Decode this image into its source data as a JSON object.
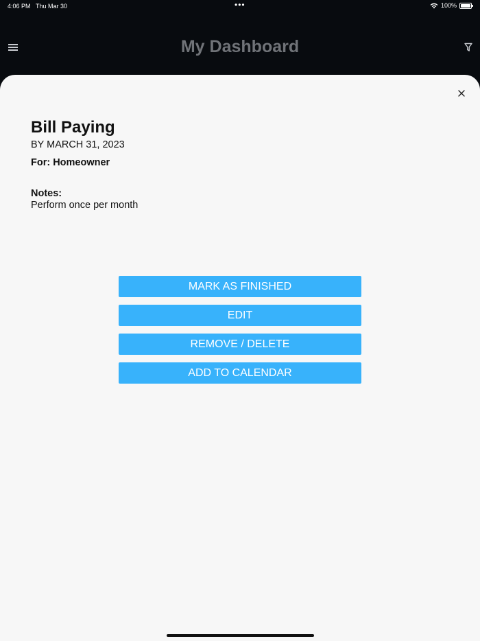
{
  "status_bar": {
    "time": "4:06 PM",
    "date": "Thu Mar 30",
    "battery": "100%",
    "battery_level": 1.0
  },
  "header": {
    "title": "My Dashboard",
    "menu_icon": "hamburger-menu-icon",
    "filter_icon": "filter-icon"
  },
  "task": {
    "title": "Bill Paying",
    "due": "BY MARCH 31, 2023",
    "for": "For: Homeowner",
    "notes_label": "Notes:",
    "notes": "Perform once per month"
  },
  "actions": {
    "mark_finished": "MARK AS FINISHED",
    "edit": "EDIT",
    "delete": "REMOVE / DELETE",
    "calendar": "ADD TO CALENDAR"
  },
  "colors": {
    "accent": "#38b2fb",
    "sheet_bg": "#f7f7f7",
    "app_bg": "#080b0f"
  }
}
